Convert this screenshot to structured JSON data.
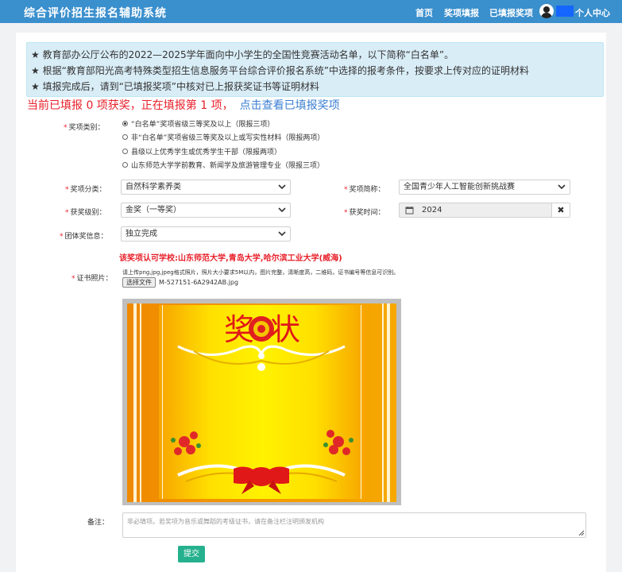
{
  "header": {
    "brand": "综合评价招生报名辅助系统",
    "nav": [
      {
        "label": "首页"
      },
      {
        "label": "奖项填报"
      },
      {
        "label": "已填报奖项"
      }
    ],
    "user_center": "个人中心"
  },
  "notice": {
    "lines": [
      "★ 教育部办公厅公布的2022—2025学年面向中小学生的全国性竞赛活动名单，以下简称“白名单”。",
      "★ 根据“教育部阳光高考特殊类型招生信息服务平台综合评价报名系统”中选择的报考条件，按要求上传对应的证明材料",
      "★ 填报完成后，请到“已填报奖项”中核对已上报获奖证书等证明材料"
    ]
  },
  "status": {
    "text": "当前已填报 0 项获奖，正在填报第 1 项，",
    "link": "点击查看已填报奖项"
  },
  "form": {
    "category": {
      "label": "奖项类别：",
      "options": [
        "“白名单”奖项省级三等奖及以上（限报三项）",
        "非“白名单”奖项省级三等奖及以上或写实性材料（限报两项）",
        "县级以上优秀学生或优秀学生干部（限报两项）",
        "山东师范大学学前教育、新闻学及旅游管理专业（限报三项）"
      ],
      "selected_index": 0
    },
    "classification": {
      "label": "奖项分类：",
      "value": "自然科学素养类"
    },
    "award_name": {
      "label": "奖项简称：",
      "value": "全国青少年人工智能创新挑战赛"
    },
    "award_level": {
      "label": "获奖级别：",
      "value": "金奖（一等奖）"
    },
    "award_time": {
      "label": "获奖时间：",
      "value": "2024"
    },
    "team": {
      "label": "团体奖信息：",
      "value": "独立完成"
    },
    "schools_notice": "该奖项认可学校:山东师范大学,青岛大学,哈尔滨工业大学(威海)",
    "certificate": {
      "label": "证书照片：",
      "hint": "请上传png,jpg,jpeg格式照片，照片大小要求5M以内，图片完整，清晰度高，二维码，证书编号等信息可识别。",
      "button": "选择文件",
      "filename": "M-527151-6A2942AB.jpg",
      "image_text": [
        "奖",
        "状"
      ]
    },
    "remark": {
      "label": "备注：",
      "placeholder": "非必填项。若奖项为音乐或舞蹈的考级证书，请在备注栏注明颁发机构"
    },
    "submit": "提交"
  },
  "colors": {
    "header_bg": "#3a8fcd",
    "notice_bg": "#d9edf7",
    "status_red": "#e8202a",
    "link_blue": "#3b7fd2",
    "submit_green": "#26b18e"
  }
}
